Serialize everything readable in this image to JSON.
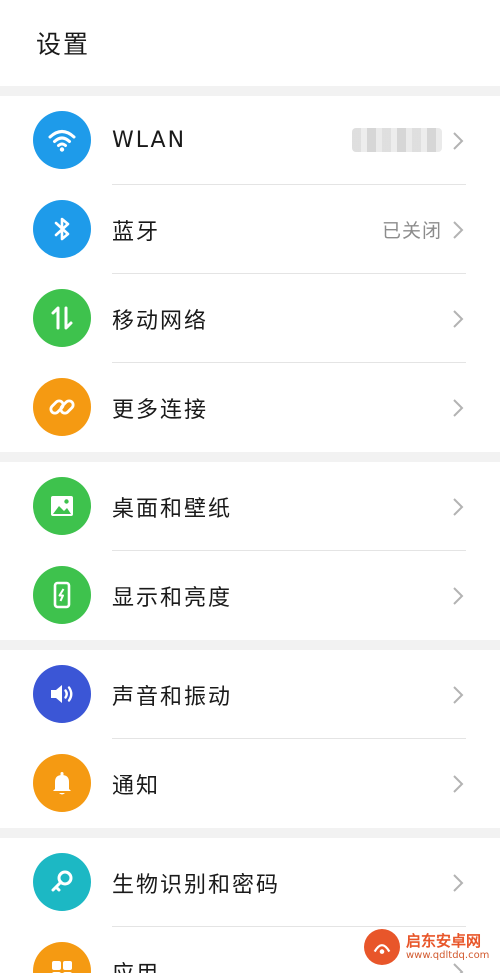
{
  "header": {
    "title": "设置"
  },
  "colors": {
    "blue": "#1e9bea",
    "green": "#3ec24d",
    "orange": "#f59a12",
    "indigo": "#3b56d6",
    "teal": "#1cb8c4"
  },
  "groups": [
    {
      "items": [
        {
          "label": "WLAN",
          "value": "",
          "icon": "wifi-icon"
        },
        {
          "label": "蓝牙",
          "value": "已关闭",
          "icon": "bluetooth-icon"
        },
        {
          "label": "移动网络",
          "value": "",
          "icon": "mobile-data-icon"
        },
        {
          "label": "更多连接",
          "value": "",
          "icon": "link-icon"
        }
      ]
    },
    {
      "items": [
        {
          "label": "桌面和壁纸",
          "value": "",
          "icon": "image-icon"
        },
        {
          "label": "显示和亮度",
          "value": "",
          "icon": "display-brightness-icon"
        }
      ]
    },
    {
      "items": [
        {
          "label": "声音和振动",
          "value": "",
          "icon": "speaker-icon"
        },
        {
          "label": "通知",
          "value": "",
          "icon": "bell-icon"
        }
      ]
    },
    {
      "items": [
        {
          "label": "生物识别和密码",
          "value": "",
          "icon": "key-icon"
        },
        {
          "label": "应用",
          "value": "",
          "icon": "apps-icon"
        }
      ]
    }
  ],
  "watermark": {
    "name": "启东安卓网",
    "url": "www.qdltdq.com"
  }
}
